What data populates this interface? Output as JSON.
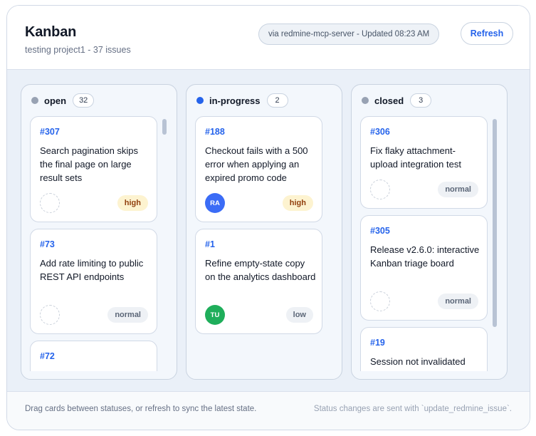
{
  "header": {
    "title": "Kanban",
    "subtitle": "testing project1 - 37 issues",
    "meta": "via redmine-mcp-server - Updated 08:23 AM",
    "refresh_label": "Refresh"
  },
  "colors": {
    "accent": "#2563eb",
    "open_dot": "#98a2b3",
    "in_progress_dot": "#2563eb",
    "closed_dot": "#98a2b3",
    "avatar_ra": "#3b6cf6",
    "avatar_tu": "#1fae5b"
  },
  "columns": [
    {
      "name": "open",
      "count": "32",
      "cards": [
        {
          "id": "#307",
          "title": "Search pagination skips the final page on large result sets",
          "priority": "high",
          "avatar": ""
        },
        {
          "id": "#73",
          "title": "Add rate limiting to public REST API endpoints",
          "priority": "normal",
          "avatar": ""
        },
        {
          "id": "#72",
          "title": "",
          "priority": "",
          "avatar": ""
        }
      ]
    },
    {
      "name": "in-progress",
      "count": "2",
      "cards": [
        {
          "id": "#188",
          "title": "Checkout fails with a 500 error when applying an expired promo code",
          "priority": "high",
          "avatar": "RA"
        },
        {
          "id": "#1",
          "title": "Refine empty-state copy on the analytics dashboard",
          "priority": "low",
          "avatar": "TU"
        }
      ]
    },
    {
      "name": "closed",
      "count": "3",
      "cards": [
        {
          "id": "#306",
          "title": "Fix flaky attachment-upload integration test",
          "priority": "normal",
          "avatar": ""
        },
        {
          "id": "#305",
          "title": "Release v2.6.0: interactive Kanban triage board",
          "priority": "normal",
          "avatar": ""
        },
        {
          "id": "#19",
          "title": "Session not invalidated",
          "priority": "",
          "avatar": ""
        }
      ]
    }
  ],
  "footer": {
    "hint": "Drag cards between statuses, or refresh to sync the latest state.",
    "note": "Status changes are sent with `update_redmine_issue`."
  }
}
